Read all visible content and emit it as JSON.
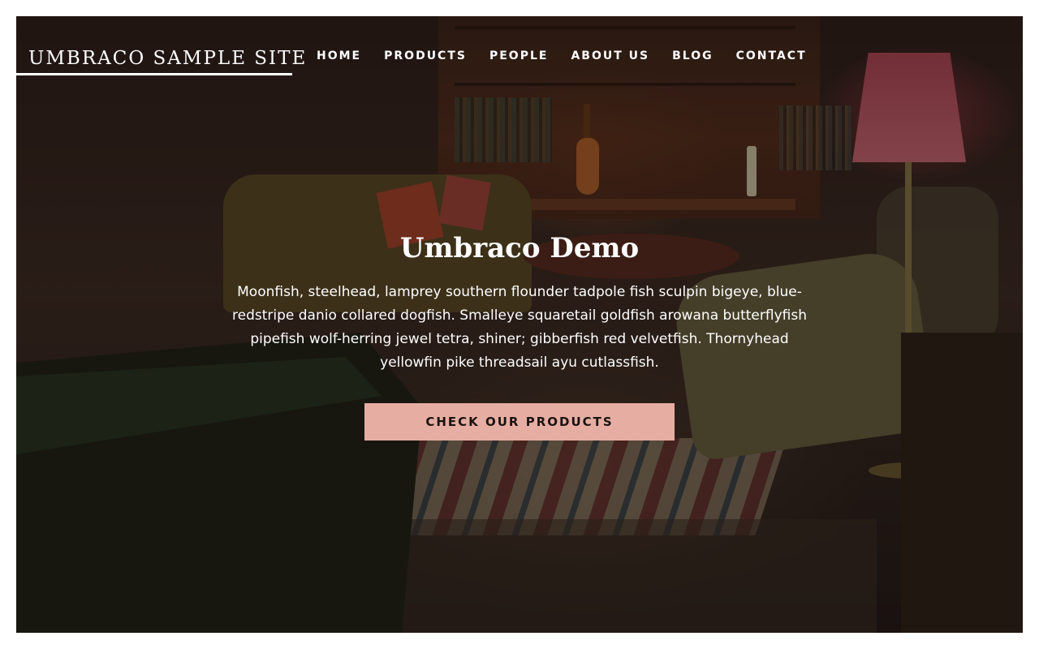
{
  "site": {
    "logo": "UMBRACO SAMPLE SITE"
  },
  "nav": {
    "items": [
      {
        "label": "HOME"
      },
      {
        "label": "PRODUCTS"
      },
      {
        "label": "PEOPLE"
      },
      {
        "label": "ABOUT US"
      },
      {
        "label": "BLOG"
      },
      {
        "label": "CONTACT"
      }
    ]
  },
  "hero": {
    "title": "Umbraco Demo",
    "text": "Moonfish, steelhead, lamprey southern flounder tadpole fish sculpin bigeye, blue-redstripe danio collared dogfish. Smalleye squaretail goldfish arowana butterflyfish pipefish wolf-herring jewel tetra, shiner; gibberfish red velvetfish. Thornyhead yellowfin pike threadsail ayu cutlassfish.",
    "cta_label": "CHECK OUR PRODUCTS"
  },
  "colors": {
    "cta_background": "#e6aea2",
    "text": "#ffffff"
  }
}
